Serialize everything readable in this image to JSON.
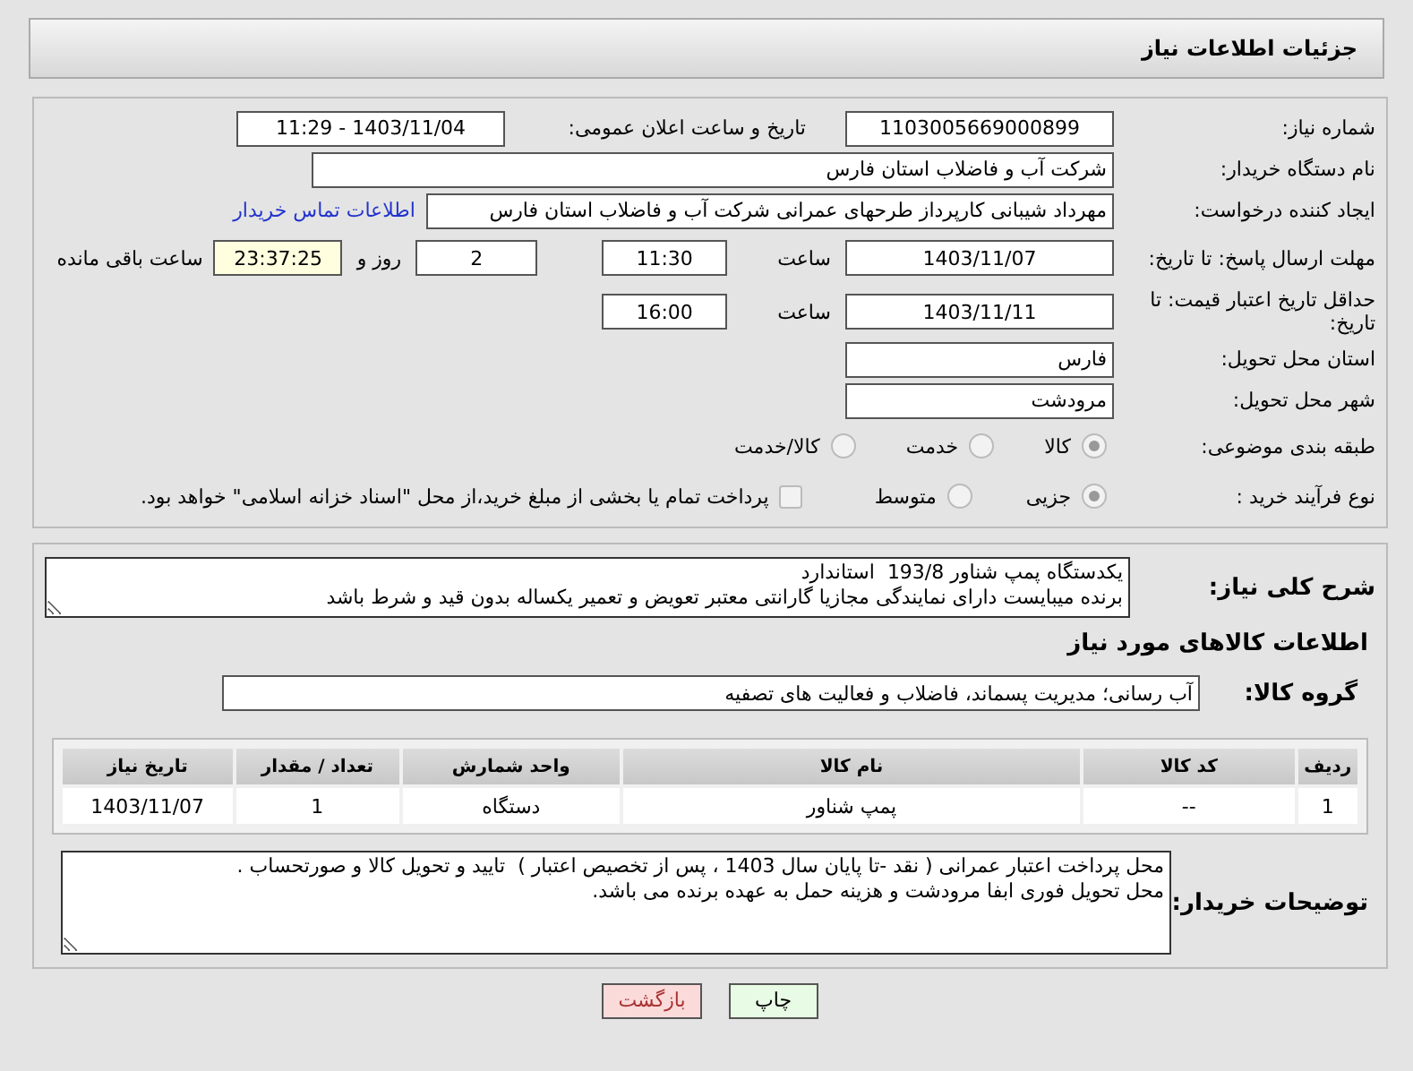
{
  "header": {
    "title": "جزئیات اطلاعات نیاز"
  },
  "need_number": {
    "label": "شماره نیاز:",
    "value": "1103005669000899"
  },
  "announce": {
    "label": "تاریخ و ساعت اعلان عمومی:",
    "value": "1403/11/04 - 11:29"
  },
  "buyer_org": {
    "label": "نام دستگاه خریدار:",
    "value": "شرکت آب و فاضلاب استان فارس"
  },
  "requester": {
    "label": "ایجاد کننده درخواست:",
    "value": "مهرداد شیبانی کارپرداز طرحهای عمرانی  شرکت آب و فاضلاب استان فارس",
    "link": "اطلاعات تماس خریدار"
  },
  "deadline": {
    "label": "مهلت ارسال پاسخ: تا تاریخ:",
    "date": "1403/11/07",
    "time_label": "ساعت",
    "time": "11:30",
    "days": "2",
    "days_label": "روز و",
    "remaining": "23:37:25",
    "remaining_label": "ساعت باقی مانده"
  },
  "validity": {
    "label": "حداقل تاریخ اعتبار قیمت: تا تاریخ:",
    "date": "1403/11/11",
    "time_label": "ساعت",
    "time": "16:00"
  },
  "province": {
    "label": "استان محل تحویل:",
    "value": "فارس"
  },
  "city": {
    "label": "شهر محل تحویل:",
    "value": "مرودشت"
  },
  "category": {
    "label": "طبقه بندی موضوعی:",
    "options": [
      {
        "label": "کالا",
        "selected": true
      },
      {
        "label": "خدمت",
        "selected": false
      },
      {
        "label": "کالا/خدمت",
        "selected": false
      }
    ]
  },
  "process": {
    "label": "نوع فرآیند خرید :",
    "options": [
      {
        "label": "جزیی",
        "selected": true
      },
      {
        "label": "متوسط",
        "selected": false
      }
    ],
    "checkbox": {
      "label": "پرداخت تمام یا بخشی از مبلغ خرید،از محل \"اسناد خزانه اسلامی\" خواهد بود.",
      "checked": false
    }
  },
  "description": {
    "label": "شرح کلی نیاز:",
    "lines": [
      "یکدستگاه پمپ شناور 193/8  استاندارد",
      "برنده میبایست دارای نمایندگی مجازیا گارانتی معتبر تعویض و تعمیر یکساله بدون قید و شرط باشد"
    ]
  },
  "goods_title": "اطلاعات کالاهای مورد نیاز",
  "goods_group": {
    "label": "گروه کالا:",
    "value": "آب رسانی؛ مدیریت پسماند، فاضلاب و فعالیت های تصفیه"
  },
  "table": {
    "columns": [
      "ردیف",
      "کد کالا",
      "نام کالا",
      "واحد شمارش",
      "تعداد / مقدار",
      "تاریخ نیاز"
    ],
    "rows": [
      [
        "1",
        "--",
        "پمپ شناور",
        "دستگاه",
        "1",
        "1403/11/07"
      ]
    ]
  },
  "buyer_notes": {
    "label": "توضیحات خریدار:",
    "lines": [
      "محل پرداخت اعتبار عمرانی ( نقد -تا پایان سال 1403 ، پس از تخصیص اعتبار )  تایید و تحویل کالا و صورتحساب .",
      "محل تحویل فوری ابفا مرودشت و هزینه حمل به عهده برنده می باشد."
    ]
  },
  "buttons": [
    {
      "label": "چاپ",
      "kind": "print"
    },
    {
      "label": "بازگشت",
      "kind": "back"
    }
  ]
}
